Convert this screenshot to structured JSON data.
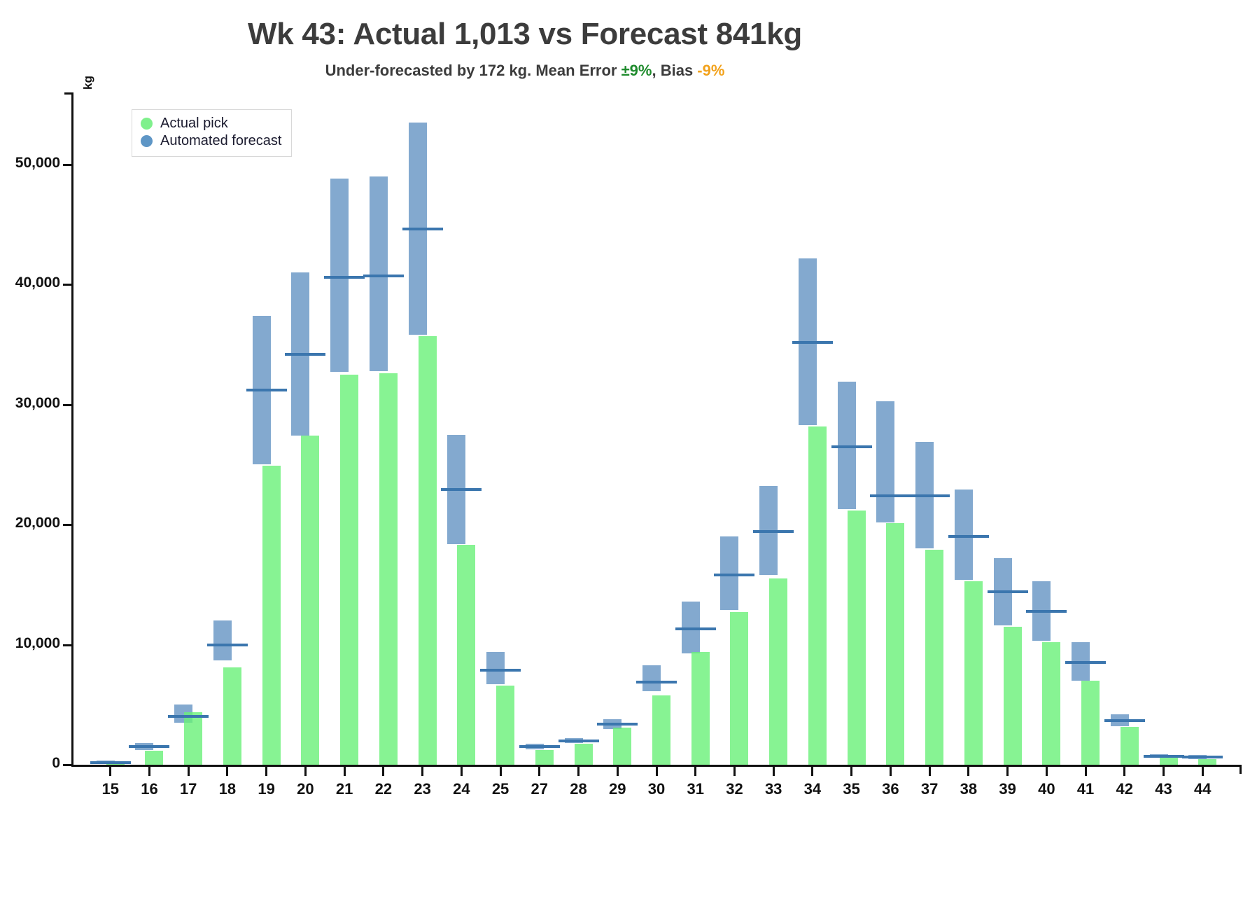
{
  "title": "Wk 43: Actual 1,013 vs Forecast 841kg",
  "subtitle": {
    "lead": "Under-forecasted by 172 kg. Mean Error ",
    "mean_error": "±9%",
    "mid": ", Bias ",
    "bias": "-9%"
  },
  "colors": {
    "actual": "#7ff08c",
    "forecast": "#5e96c6",
    "forecast_line": "#3b76ae",
    "overlap": "#55a6ad",
    "mean_error_text": "#1f8b2d",
    "bias_text": "#f2a21c",
    "axis": "#111111",
    "title_text": "#3c3c3c"
  },
  "legend": {
    "position": "top-left",
    "items": [
      {
        "label": "Actual pick",
        "color": "#7ff08c",
        "marker": "circle-marker"
      },
      {
        "label": "Automated forecast",
        "color": "#5e96c6",
        "marker": "circle-marker"
      }
    ]
  },
  "chart_data": {
    "type": "bar",
    "title": "Wk 43: Actual 1,013 vs Forecast 841kg",
    "subtitle": "Under-forecasted by 172 kg. Mean Error ±9%, Bias -9%",
    "xlabel": "",
    "ylabel": "kg",
    "ylim": [
      0,
      56000
    ],
    "yticks": [
      0,
      10000,
      20000,
      30000,
      40000,
      50000
    ],
    "ytick_labels": [
      "0",
      "10,000",
      "20,000",
      "30,000",
      "40,000",
      "50,000"
    ],
    "grid": false,
    "categories": [
      "15",
      "16",
      "17",
      "18",
      "19",
      "20",
      "21",
      "22",
      "23",
      "24",
      "25",
      "27",
      "28",
      "29",
      "30",
      "31",
      "32",
      "33",
      "34",
      "35",
      "36",
      "37",
      "38",
      "39",
      "40",
      "41",
      "42",
      "43",
      "44"
    ],
    "series": [
      {
        "name": "Actual pick",
        "color": "#7ff08c",
        "values": [
          150,
          1150,
          4400,
          8100,
          24900,
          27400,
          32500,
          32600,
          35700,
          18300,
          6600,
          1250,
          1750,
          3100,
          5800,
          9400,
          12700,
          15500,
          28200,
          21200,
          20100,
          17900,
          15300,
          11500,
          10200,
          7000,
          3150,
          600,
          450
        ]
      },
      {
        "name": "Automated forecast",
        "color": "#5e96c6",
        "values": [
          200,
          1500,
          4000,
          10000,
          31200,
          34200,
          40600,
          40700,
          44600,
          22900,
          7900,
          1500,
          2000,
          3400,
          6900,
          11300,
          15800,
          19400,
          35200,
          26500,
          22400,
          22400,
          19000,
          14400,
          12800,
          8500,
          3700,
          700,
          650
        ],
        "range_low": [
          50,
          1200,
          3500,
          8700,
          25000,
          27400,
          32700,
          32800,
          35800,
          18400,
          6700,
          1300,
          1800,
          3000,
          6100,
          9300,
          12900,
          15800,
          28300,
          21300,
          20200,
          18000,
          15400,
          11600,
          10300,
          7000,
          3200,
          600,
          450
        ],
        "range_high": [
          350,
          1800,
          5000,
          12000,
          37400,
          41000,
          48800,
          49000,
          53500,
          27500,
          9400,
          1750,
          2200,
          3800,
          8300,
          13600,
          19000,
          23200,
          42200,
          31900,
          30300,
          26900,
          22900,
          17200,
          15300,
          10200,
          4200,
          850,
          800
        ]
      }
    ]
  }
}
